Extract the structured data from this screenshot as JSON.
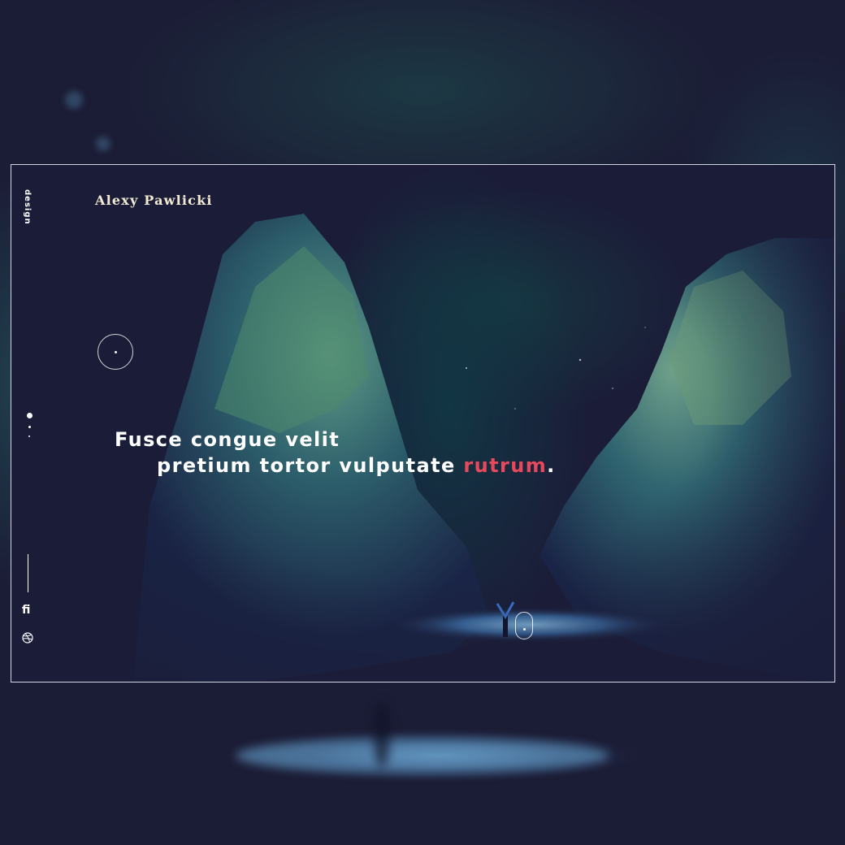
{
  "header": {
    "brand": "Alexy Pawlicki"
  },
  "sidebar": {
    "label": "design",
    "pager": {
      "pages": 3,
      "active": 1
    },
    "social": [
      {
        "name": "fi",
        "icon": "fi-icon"
      },
      {
        "name": "dribbble",
        "icon": "dribbble-icon"
      }
    ]
  },
  "hero": {
    "line1": "Fusce congue velit",
    "line2_main": "pretium tortor vulputate ",
    "line2_accent": "rutrum",
    "line2_end": "."
  },
  "colors": {
    "accent": "#e8485c",
    "background": "#1b1d38",
    "text": "#ffffff",
    "brand_text": "#f2ead2"
  }
}
